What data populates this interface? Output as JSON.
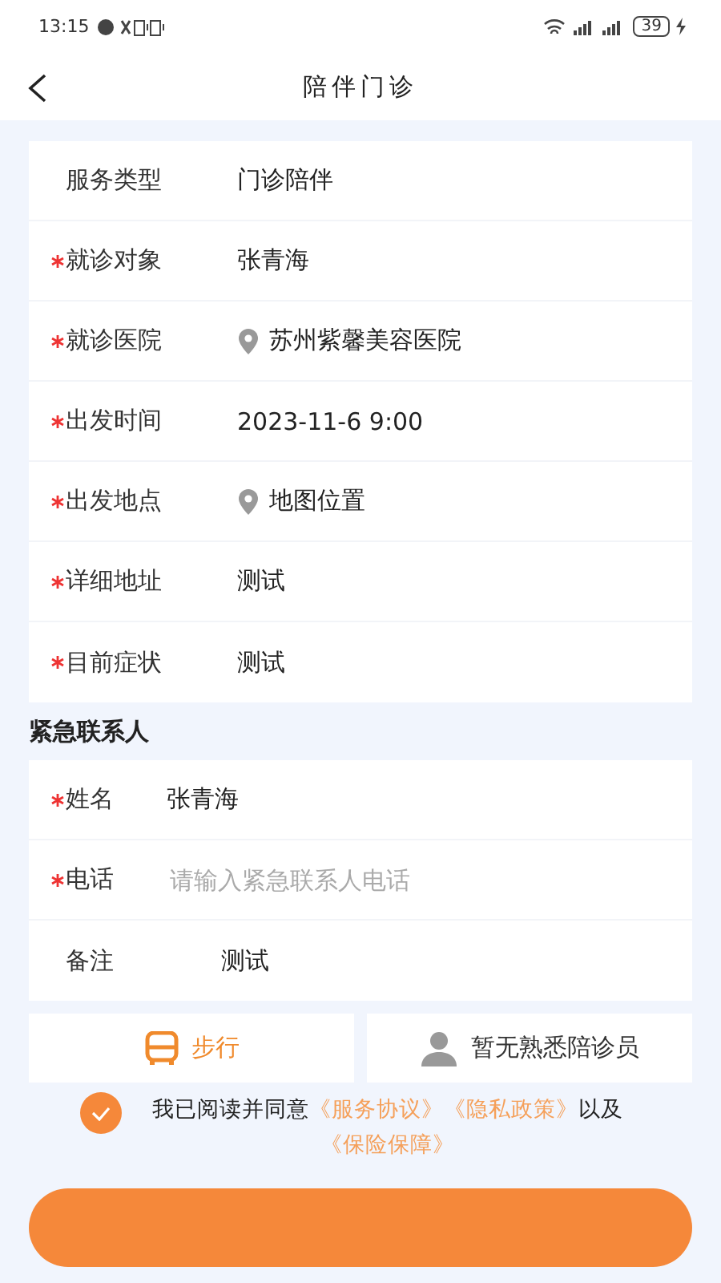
{
  "status_bar": {
    "time": "13:15",
    "battery": "39"
  },
  "header": {
    "title": "陪伴门诊"
  },
  "service_form": [
    {
      "label": "服务类型",
      "required": false,
      "value": "门诊陪伴",
      "kind": "plain"
    },
    {
      "label": "就诊对象",
      "required": true,
      "value": "张青海",
      "kind": "plain"
    },
    {
      "label": "就诊医院",
      "required": true,
      "value": "苏州紫馨美容医院",
      "kind": "location"
    },
    {
      "label": "出发时间",
      "required": true,
      "value": "2023-11-6 9:00",
      "kind": "plain"
    },
    {
      "label": "出发地点",
      "required": true,
      "value": "地图位置",
      "kind": "location"
    },
    {
      "label": "详细地址",
      "required": true,
      "value": "测试",
      "kind": "plain"
    },
    {
      "label": "目前症状",
      "required": true,
      "value": "测试",
      "kind": "plain"
    }
  ],
  "emergency": {
    "title": "紧急联系人",
    "fields": [
      {
        "label": "姓名",
        "required": true,
        "value": "张青海"
      },
      {
        "label": "电话",
        "required": true,
        "placeholder": "请输入紧急联系人电话"
      },
      {
        "label": "备注",
        "required": false,
        "value": "测试"
      }
    ]
  },
  "options": [
    {
      "kind": "bus",
      "label": "步行",
      "active": true
    },
    {
      "kind": "person",
      "label": "暂无熟悉陪诊员",
      "active": false
    }
  ],
  "agreement": {
    "checked": true,
    "text": "我已阅读并同意",
    "links": [
      "《服务协议》",
      "《隐私政策》"
    ],
    "joiner": "以及",
    "last_link": "《保险保障》"
  }
}
